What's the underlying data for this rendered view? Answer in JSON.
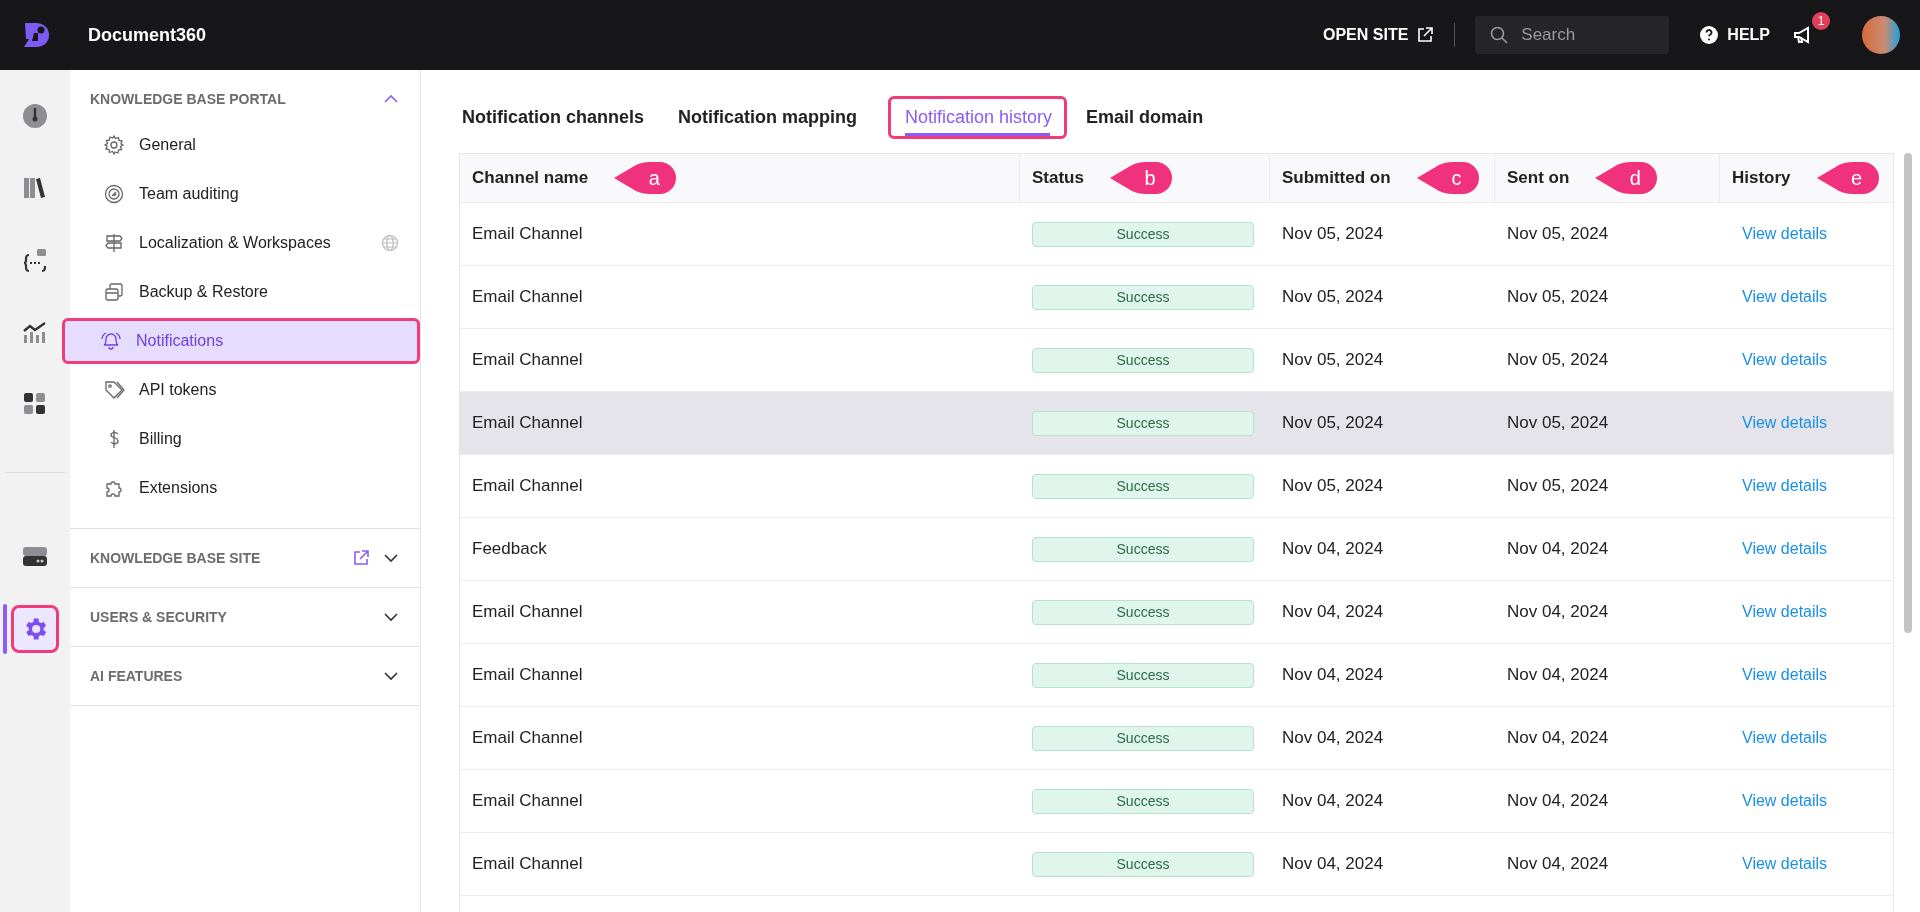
{
  "topbar": {
    "brand": "Document360",
    "open_site": "OPEN SITE",
    "search": {
      "placeholder": "Search"
    },
    "help": "HELP",
    "notification_count": "1"
  },
  "rail": [
    {
      "kind": "dashboard",
      "selected": false,
      "highlighted": false
    },
    {
      "kind": "documents",
      "selected": false,
      "highlighted": false
    },
    {
      "kind": "api",
      "selected": false,
      "highlighted": false
    },
    {
      "kind": "analytics",
      "selected": false,
      "highlighted": false
    },
    {
      "kind": "apps",
      "selected": false,
      "highlighted": false
    },
    {
      "kind": "drive",
      "selected": false,
      "highlighted": false
    },
    {
      "kind": "settings",
      "selected": true,
      "highlighted": true
    }
  ],
  "sidebar": {
    "sections": [
      {
        "title": "KNOWLEDGE BASE PORTAL",
        "expanded": true,
        "external_link": false,
        "items": [
          {
            "label": "General",
            "kind": "gear",
            "selected": false,
            "highlighted": false,
            "globe": false
          },
          {
            "label": "Team auditing",
            "kind": "audit",
            "selected": false,
            "highlighted": false,
            "globe": false
          },
          {
            "label": "Localization & Workspaces",
            "kind": "signpost",
            "selected": false,
            "highlighted": false,
            "globe": true
          },
          {
            "label": "Backup & Restore",
            "kind": "backup",
            "selected": false,
            "highlighted": false,
            "globe": false
          },
          {
            "label": "Notifications",
            "kind": "bell",
            "selected": true,
            "highlighted": true,
            "globe": false
          },
          {
            "label": "API tokens",
            "kind": "tag",
            "selected": false,
            "highlighted": false,
            "globe": false
          },
          {
            "label": "Billing",
            "kind": "dollar",
            "selected": false,
            "highlighted": false,
            "globe": false
          },
          {
            "label": "Extensions",
            "kind": "puzzle",
            "selected": false,
            "highlighted": false,
            "globe": false
          }
        ]
      },
      {
        "title": "KNOWLEDGE BASE SITE",
        "expanded": false,
        "external_link": true
      },
      {
        "title": "USERS & SECURITY",
        "expanded": false,
        "external_link": false
      },
      {
        "title": "AI FEATURES",
        "expanded": false,
        "external_link": false
      }
    ]
  },
  "tabs": [
    {
      "label": "Notification channels",
      "selected": false,
      "highlighted": false
    },
    {
      "label": "Notification mapping",
      "selected": false,
      "highlighted": false
    },
    {
      "label": "Notification history",
      "selected": true,
      "highlighted": true
    },
    {
      "label": "Email domain",
      "selected": false,
      "highlighted": false
    }
  ],
  "table": {
    "columns": [
      {
        "label": "Channel name",
        "callout": "a"
      },
      {
        "label": "Status",
        "callout": "b"
      },
      {
        "label": "Submitted on",
        "callout": "c"
      },
      {
        "label": "Sent on",
        "callout": "d"
      },
      {
        "label": "History",
        "callout": "e"
      }
    ],
    "rows": [
      {
        "channel": "Email Channel",
        "status": "Success",
        "submitted_on": "Nov 05, 2024",
        "sent_on": "Nov 05, 2024",
        "history": "View details",
        "hovered": false
      },
      {
        "channel": "Email Channel",
        "status": "Success",
        "submitted_on": "Nov 05, 2024",
        "sent_on": "Nov 05, 2024",
        "history": "View details",
        "hovered": false
      },
      {
        "channel": "Email Channel",
        "status": "Success",
        "submitted_on": "Nov 05, 2024",
        "sent_on": "Nov 05, 2024",
        "history": "View details",
        "hovered": false
      },
      {
        "channel": "Email Channel",
        "status": "Success",
        "submitted_on": "Nov 05, 2024",
        "sent_on": "Nov 05, 2024",
        "history": "View details",
        "hovered": true
      },
      {
        "channel": "Email Channel",
        "status": "Success",
        "submitted_on": "Nov 05, 2024",
        "sent_on": "Nov 05, 2024",
        "history": "View details",
        "hovered": false
      },
      {
        "channel": "Feedback",
        "status": "Success",
        "submitted_on": "Nov 04, 2024",
        "sent_on": "Nov 04, 2024",
        "history": "View details",
        "hovered": false
      },
      {
        "channel": "Email Channel",
        "status": "Success",
        "submitted_on": "Nov 04, 2024",
        "sent_on": "Nov 04, 2024",
        "history": "View details",
        "hovered": false
      },
      {
        "channel": "Email Channel",
        "status": "Success",
        "submitted_on": "Nov 04, 2024",
        "sent_on": "Nov 04, 2024",
        "history": "View details",
        "hovered": false
      },
      {
        "channel": "Email Channel",
        "status": "Success",
        "submitted_on": "Nov 04, 2024",
        "sent_on": "Nov 04, 2024",
        "history": "View details",
        "hovered": false
      },
      {
        "channel": "Email Channel",
        "status": "Success",
        "submitted_on": "Nov 04, 2024",
        "sent_on": "Nov 04, 2024",
        "history": "View details",
        "hovered": false
      },
      {
        "channel": "Email Channel",
        "status": "Success",
        "submitted_on": "Nov 04, 2024",
        "sent_on": "Nov 04, 2024",
        "history": "View details",
        "hovered": false
      }
    ]
  }
}
